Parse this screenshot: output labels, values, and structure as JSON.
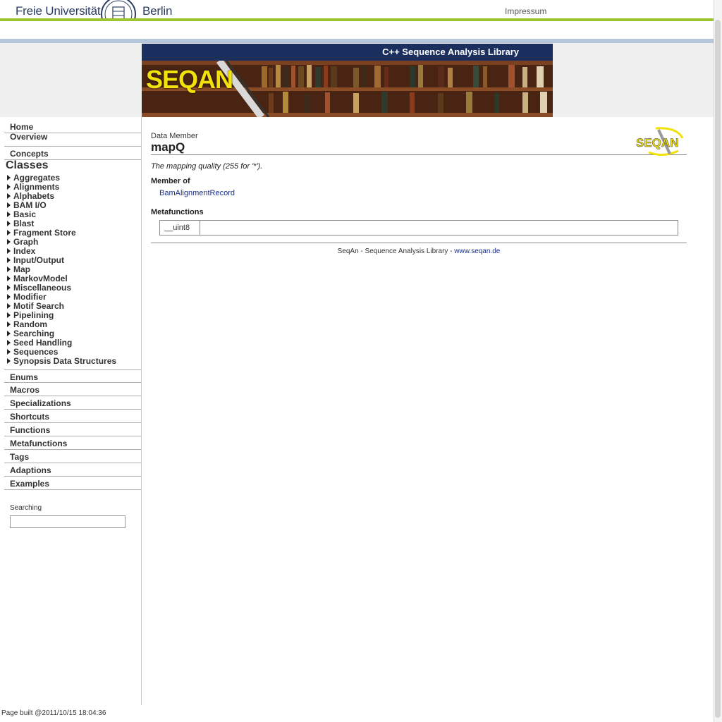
{
  "header": {
    "university_left": "Freie Universität",
    "university_right": "Berlin",
    "impressum": "Impressum"
  },
  "banner": {
    "title": "C++ Sequence Analysis Library",
    "logo_text": "SEQAN"
  },
  "sidebar": {
    "top_items": [
      {
        "label": "Home"
      },
      {
        "label": "Overview"
      },
      {
        "label": "Concepts"
      }
    ],
    "classes_heading": "Classes",
    "class_items": [
      {
        "label": "Aggregates"
      },
      {
        "label": "Alignments"
      },
      {
        "label": "Alphabets"
      },
      {
        "label": "BAM I/O"
      },
      {
        "label": "Basic"
      },
      {
        "label": "Blast"
      },
      {
        "label": "Fragment Store"
      },
      {
        "label": "Graph"
      },
      {
        "label": "Index"
      },
      {
        "label": "Input/Output"
      },
      {
        "label": "Map"
      },
      {
        "label": "MarkovModel"
      },
      {
        "label": "Miscellaneous"
      },
      {
        "label": "Modifier"
      },
      {
        "label": "Motif Search"
      },
      {
        "label": "Pipelining"
      },
      {
        "label": "Random"
      },
      {
        "label": "Searching"
      },
      {
        "label": "Seed Handling"
      },
      {
        "label": "Sequences"
      },
      {
        "label": "Synopsis Data Structures"
      }
    ],
    "bottom_items": [
      {
        "label": "Enums"
      },
      {
        "label": "Macros"
      },
      {
        "label": "Specializations"
      },
      {
        "label": "Shortcuts"
      },
      {
        "label": "Functions"
      },
      {
        "label": "Metafunctions"
      },
      {
        "label": "Tags"
      },
      {
        "label": "Adaptions"
      },
      {
        "label": "Examples"
      }
    ],
    "search_label": "Searching",
    "search_value": ""
  },
  "main": {
    "kind": "Data Member",
    "title": "mapQ",
    "description": "The mapping quality (255 for '*').",
    "member_of_heading": "Member of",
    "member_of_link": "BamAlignmentRecord",
    "metafunctions_heading": "Metafunctions",
    "metafunctions": [
      {
        "name": "__uint8"
      }
    ],
    "small_logo_text": "SEQAN"
  },
  "footer": {
    "text": "SeqAn - Sequence Analysis Library - ",
    "link": "www.seqan.de",
    "page_built": "Page built @2011/10/15 18:04:36"
  },
  "colors": {
    "green_accent": "#9cc42e",
    "blue_band": "#b6c7dc",
    "banner_navy": "#1b2f5e",
    "seqan_yellow": "#f2e10a",
    "link_blue": "#1a2e8a"
  }
}
